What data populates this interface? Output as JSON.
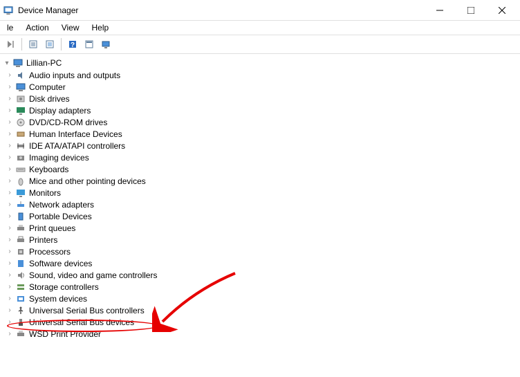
{
  "window": {
    "title": "Device Manager"
  },
  "menu": {
    "items": [
      "le",
      "Action",
      "View",
      "Help"
    ]
  },
  "tree": {
    "root": "Lillian-PC",
    "nodes": [
      {
        "label": "Audio inputs and outputs",
        "icon": "audio"
      },
      {
        "label": "Computer",
        "icon": "computer"
      },
      {
        "label": "Disk drives",
        "icon": "disk"
      },
      {
        "label": "Display adapters",
        "icon": "display"
      },
      {
        "label": "DVD/CD-ROM drives",
        "icon": "dvd"
      },
      {
        "label": "Human Interface Devices",
        "icon": "hid"
      },
      {
        "label": "IDE ATA/ATAPI controllers",
        "icon": "ide"
      },
      {
        "label": "Imaging devices",
        "icon": "imaging"
      },
      {
        "label": "Keyboards",
        "icon": "keyboard"
      },
      {
        "label": "Mice and other pointing devices",
        "icon": "mouse"
      },
      {
        "label": "Monitors",
        "icon": "monitor"
      },
      {
        "label": "Network adapters",
        "icon": "network"
      },
      {
        "label": "Portable Devices",
        "icon": "portable"
      },
      {
        "label": "Print queues",
        "icon": "printqueue"
      },
      {
        "label": "Printers",
        "icon": "printer"
      },
      {
        "label": "Processors",
        "icon": "cpu"
      },
      {
        "label": "Software devices",
        "icon": "software"
      },
      {
        "label": "Sound, video and game controllers",
        "icon": "sound"
      },
      {
        "label": "Storage controllers",
        "icon": "storage"
      },
      {
        "label": "System devices",
        "icon": "system"
      },
      {
        "label": "Universal Serial Bus controllers",
        "icon": "usb",
        "highlighted": true
      },
      {
        "label": "Universal Serial Bus devices",
        "icon": "usbdev"
      },
      {
        "label": "WSD Print Provider",
        "icon": "wsd"
      }
    ]
  },
  "annotation": {
    "type": "arrow-and-circle",
    "target": "Universal Serial Bus controllers",
    "color": "#e60000"
  }
}
